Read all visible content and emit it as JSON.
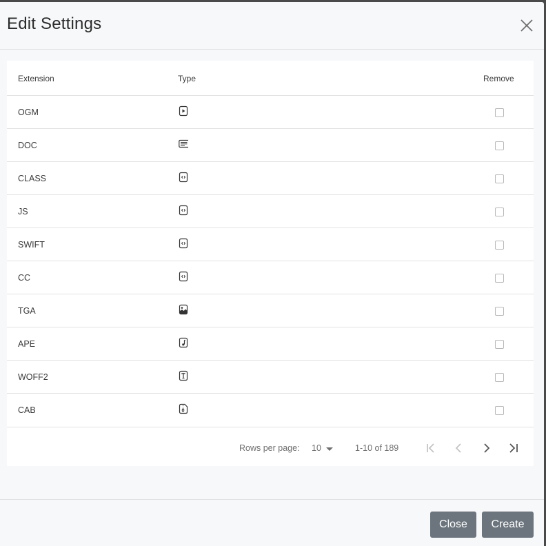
{
  "dialog": {
    "title": "Edit Settings",
    "close_icon": "close-icon"
  },
  "table": {
    "headers": {
      "extension": "Extension",
      "type": "Type",
      "remove": "Remove"
    },
    "rows": [
      {
        "extension": "OGM",
        "type_icon": "video-file-icon",
        "remove": false
      },
      {
        "extension": "DOC",
        "type_icon": "document-file-icon",
        "remove": false
      },
      {
        "extension": "CLASS",
        "type_icon": "code-file-icon",
        "remove": false
      },
      {
        "extension": "JS",
        "type_icon": "code-file-icon",
        "remove": false
      },
      {
        "extension": "SWIFT",
        "type_icon": "code-file-icon",
        "remove": false
      },
      {
        "extension": "CC",
        "type_icon": "code-file-icon",
        "remove": false
      },
      {
        "extension": "TGA",
        "type_icon": "image-file-icon",
        "remove": false
      },
      {
        "extension": "APE",
        "type_icon": "audio-file-icon",
        "remove": false
      },
      {
        "extension": "WOFF2",
        "type_icon": "font-file-icon",
        "remove": false
      },
      {
        "extension": "CAB",
        "type_icon": "archive-file-icon",
        "remove": false
      }
    ]
  },
  "pagination": {
    "rows_per_page_label": "Rows per page:",
    "rows_per_page_value": "10",
    "range": "1-10 of 189",
    "first_page_icon": "first-page-icon",
    "prev_page_icon": "chevron-left-icon",
    "next_page_icon": "chevron-right-icon",
    "last_page_icon": "last-page-icon"
  },
  "footer": {
    "close_label": "Close",
    "create_label": "Create"
  },
  "colors": {
    "button_bg": "#6c757d",
    "modal_bg": "#f7f8fa",
    "card_bg": "#ffffff"
  }
}
